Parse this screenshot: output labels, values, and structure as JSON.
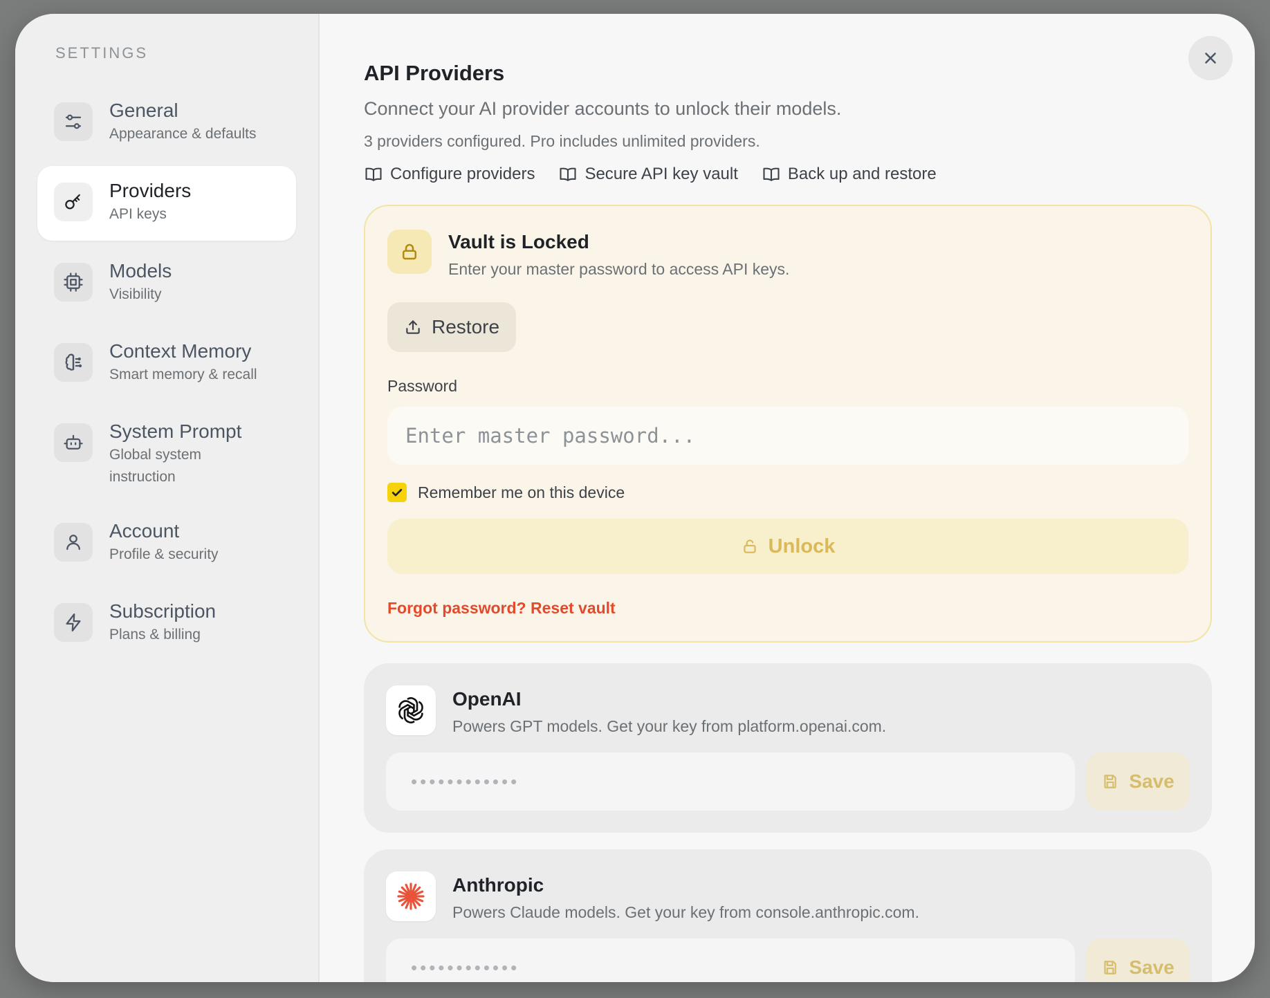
{
  "sidebar": {
    "title": "SETTINGS",
    "items": [
      {
        "label": "General",
        "sub": "Appearance & defaults",
        "icon": "sliders-icon",
        "active": false
      },
      {
        "label": "Providers",
        "sub": "API keys",
        "icon": "key-icon",
        "active": true
      },
      {
        "label": "Models",
        "sub": "Visibility",
        "icon": "cpu-icon",
        "active": false
      },
      {
        "label": "Context Memory",
        "sub": "Smart memory & recall",
        "icon": "brain-icon",
        "active": false
      },
      {
        "label": "System Prompt",
        "sub": "Global system instruction",
        "icon": "bot-icon",
        "active": false
      },
      {
        "label": "Account",
        "sub": "Profile & security",
        "icon": "user-icon",
        "active": false
      },
      {
        "label": "Subscription",
        "sub": "Plans & billing",
        "icon": "lightning-icon",
        "active": false
      }
    ]
  },
  "main": {
    "title": "API Providers",
    "subtitle": "Connect your AI provider accounts to unlock their models.",
    "note": "3 providers configured. Pro includes unlimited providers.",
    "doc_links": [
      {
        "label": "Configure providers",
        "icon": "book-icon"
      },
      {
        "label": "Secure API key vault",
        "icon": "book-icon"
      },
      {
        "label": "Back up and restore",
        "icon": "book-icon"
      }
    ]
  },
  "vault": {
    "title": "Vault is Locked",
    "description": "Enter your master password to access API keys.",
    "restore_label": "Restore",
    "password_label": "Password",
    "password_placeholder": "Enter master password...",
    "remember_label": "Remember me on this device",
    "remember_checked": true,
    "unlock_label": "Unlock",
    "reset_label": "Forgot password? Reset vault"
  },
  "providers": [
    {
      "name": "OpenAI",
      "description": "Powers GPT models. Get your key from platform.openai.com.",
      "key_placeholder": "••••••••••••",
      "save_label": "Save",
      "logo": "openai-logo"
    },
    {
      "name": "Anthropic",
      "description": "Powers Claude models. Get your key from console.anthropic.com.",
      "key_placeholder": "••••••••••••",
      "save_label": "Save",
      "logo": "anthropic-logo"
    }
  ],
  "colors": {
    "accent_yellow": "#f5d20a",
    "danger_red": "#e34a2c",
    "anthropic_orange": "#e8533a"
  }
}
